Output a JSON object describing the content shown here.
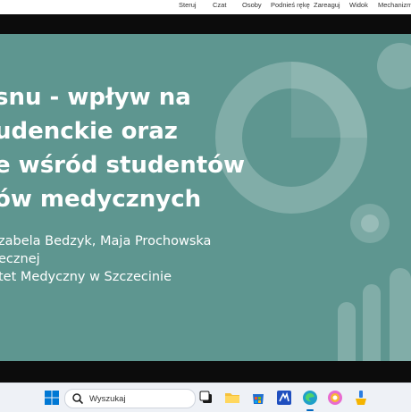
{
  "toolbar": {
    "items": [
      "Steruj",
      "Czat",
      "Osoby",
      "Podnieś rękę",
      "Zareaguj",
      "Widok",
      "Mechanizmy"
    ]
  },
  "slide": {
    "title_lines": [
      "snu - wpływ na",
      "udenckie oraz",
      "e wśród studentów",
      "ów medycznych"
    ],
    "author_lines": [
      "zabela Bedzyk, Maja Prochowska",
      "ecznej",
      "tet Medyczny w Szczecinie"
    ],
    "background_color": "#5e9690"
  },
  "taskbar": {
    "search_placeholder": "Wyszukaj",
    "icons": [
      "windows-start-icon",
      "search-icon",
      "task-view-icon",
      "file-explorer-icon",
      "store-icon",
      "app-icon",
      "edge-icon",
      "copilot-icon",
      "paint-icon"
    ]
  }
}
